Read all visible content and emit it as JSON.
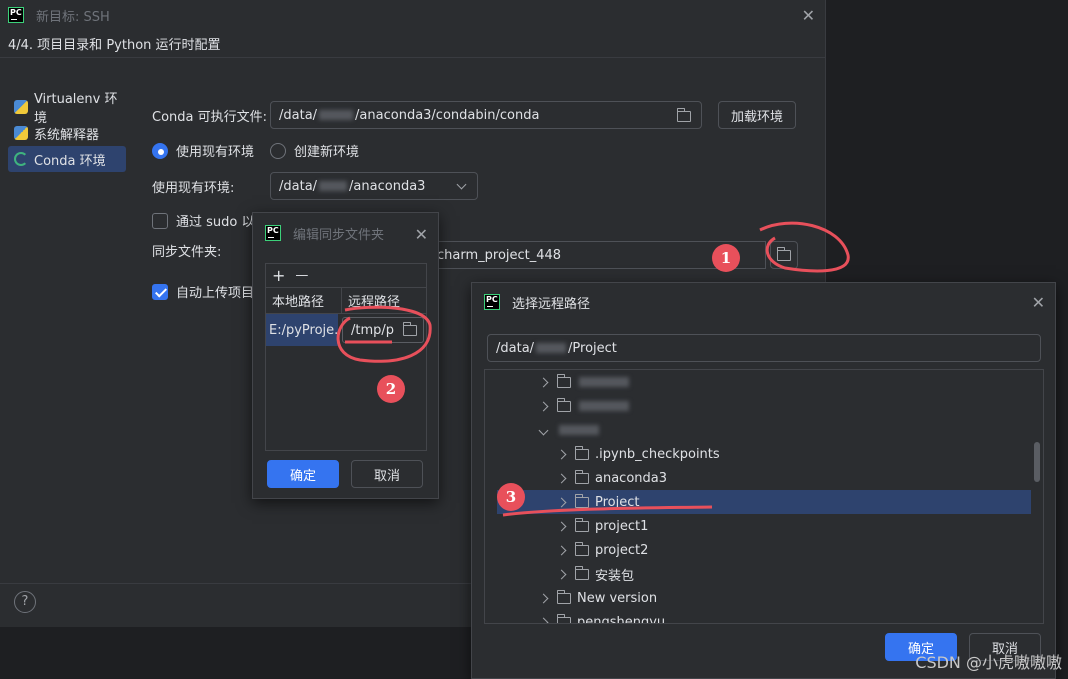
{
  "main_dialog": {
    "title": "新目标: SSH",
    "subheader": "4/4. 项目目录和 Python 运行时配置",
    "sidebar": [
      {
        "label": "Virtualenv 环境",
        "icon": "python-icon"
      },
      {
        "label": "系统解释器",
        "icon": "python-icon"
      },
      {
        "label": "Conda 环境",
        "icon": "conda-icon",
        "selected": true
      }
    ],
    "conda_exec_label": "Conda 可执行文件:",
    "conda_exec_prefix": "/data/",
    "conda_exec_suffix": "/anaconda3/condabin/conda",
    "load_env_button": "加载环境",
    "radio_use_existing": "使用现有环境",
    "radio_create_new": "创建新环境",
    "existing_env_label": "使用现有环境:",
    "existing_env_prefix": "/data/",
    "existing_env_suffix": "/anaconda3",
    "sudo_label": "通过 sudo 以",
    "sync_folder_label": "同步文件夹:",
    "sync_folder_value": "charm_project_448",
    "auto_upload_label": "自动上传项目"
  },
  "sync_dialog": {
    "title": "编辑同步文件夹",
    "add_symbol": "+",
    "remove_symbol": "—",
    "col_local": "本地路径",
    "col_remote": "远程路径",
    "local_value": "E:/pyProje..",
    "remote_value": "/tmp/p",
    "ok_button": "确定",
    "cancel_button": "取消"
  },
  "remote_dialog": {
    "title": "选择远程路径",
    "path_prefix": "/data/",
    "path_suffix": "/Project",
    "tree": [
      {
        "label": "",
        "blurred": true,
        "indent": 0,
        "expanded": false
      },
      {
        "label": "",
        "blurred": true,
        "indent": 0,
        "expanded": false
      },
      {
        "label": "",
        "blurred": true,
        "indent": 0,
        "expanded": true,
        "no_folder": true
      },
      {
        "label": ".ipynb_checkpoints",
        "indent": 1
      },
      {
        "label": "anaconda3",
        "indent": 1
      },
      {
        "label": "Project",
        "indent": 1,
        "selected": true
      },
      {
        "label": "project1",
        "indent": 1
      },
      {
        "label": "project2",
        "indent": 1
      },
      {
        "label": "安装包",
        "indent": 1
      },
      {
        "label": "New version",
        "indent": 0
      },
      {
        "label": "pengshengyu",
        "indent": 0
      }
    ],
    "ok_button": "确定",
    "cancel_button": "取消"
  },
  "annotations": {
    "badge1": "1",
    "badge2": "2",
    "badge3": "3",
    "color": "#e8505b"
  },
  "watermark": "CSDN @小虎嗷嗷嗷"
}
